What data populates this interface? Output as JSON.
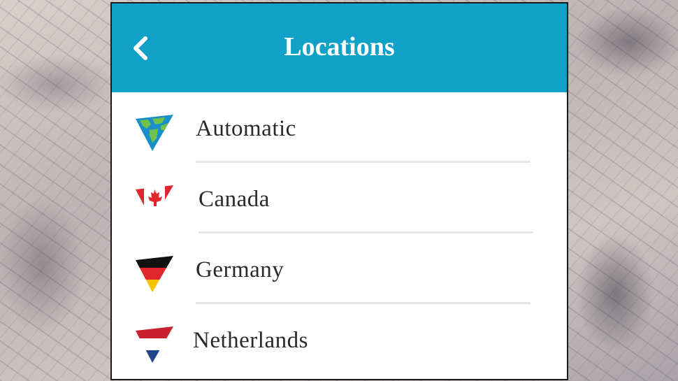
{
  "header": {
    "title": "Locations",
    "background_color": "#10a0c8",
    "back_icon": "chevron-left-icon"
  },
  "locations": [
    {
      "label": "Automatic",
      "icon": "globe-flag-icon"
    },
    {
      "label": "Canada",
      "icon": "canada-flag-icon"
    },
    {
      "label": "Germany",
      "icon": "germany-flag-icon"
    },
    {
      "label": "Netherlands",
      "icon": "netherlands-flag-icon"
    }
  ]
}
